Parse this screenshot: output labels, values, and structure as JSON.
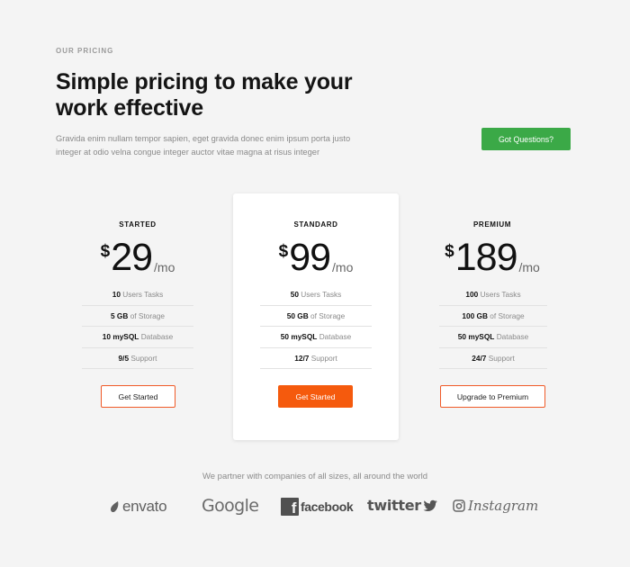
{
  "header": {
    "eyebrow": "OUR PRICING",
    "title": "Simple pricing to make your work effective",
    "subtitle": "Gravida enim nullam tempor sapien, eget gravida donec enim ipsum porta justo integer at odio velna congue integer auctor vitae magna at risus integer",
    "cta_label": "Got Questions?"
  },
  "plans": [
    {
      "name": "STARTED",
      "currency": "$",
      "amount": "29",
      "period": "/mo",
      "features": [
        {
          "value": "10",
          "label": "Users Tasks"
        },
        {
          "value": "5 GB",
          "label": "of Storage"
        },
        {
          "value": "10 mySQL",
          "label": "Database"
        },
        {
          "value": "9/5",
          "label": "Support"
        }
      ],
      "button": "Get Started"
    },
    {
      "name": "STANDARD",
      "currency": "$",
      "amount": "99",
      "period": "/mo",
      "features": [
        {
          "value": "50",
          "label": "Users Tasks"
        },
        {
          "value": "50 GB",
          "label": "of Storage"
        },
        {
          "value": "50 mySQL",
          "label": "Database"
        },
        {
          "value": "12/7",
          "label": "Support"
        }
      ],
      "button": "Get Started"
    },
    {
      "name": "PREMIUM",
      "currency": "$",
      "amount": "189",
      "period": "/mo",
      "features": [
        {
          "value": "100",
          "label": "Users Tasks"
        },
        {
          "value": "100 GB",
          "label": "of Storage"
        },
        {
          "value": "50 mySQL",
          "label": "Database"
        },
        {
          "value": "24/7",
          "label": "Support"
        }
      ],
      "button": "Upgrade to Premium"
    }
  ],
  "partners": {
    "text": "We partner with companies of all sizes, all around the world",
    "logos": [
      "envato",
      "Google",
      "facebook",
      "twitter",
      "Instagram"
    ]
  },
  "colors": {
    "background": "#f4f4f4",
    "cta_green": "#3ba947",
    "accent_orange": "#f55a0d"
  }
}
